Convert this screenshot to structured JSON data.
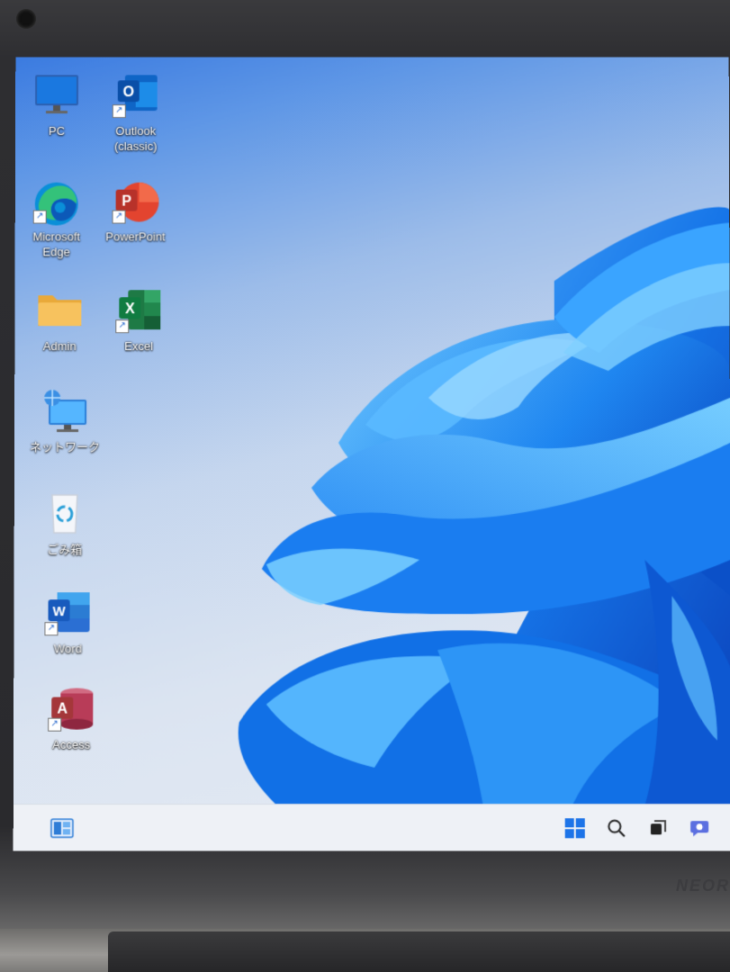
{
  "desktop": {
    "icons": [
      {
        "label": "PC",
        "icon": "monitor-icon"
      },
      {
        "label": "Outlook\n(classic)",
        "icon": "outlook-icon"
      },
      {
        "label": "Microsoft\nEdge",
        "icon": "edge-icon"
      },
      {
        "label": "PowerPoint",
        "icon": "powerpoint-icon"
      },
      {
        "label": "Admin",
        "icon": "folder-icon"
      },
      {
        "label": "Excel",
        "icon": "excel-icon"
      },
      {
        "label": "ネットワーク",
        "icon": "network-icon"
      },
      {
        "label": "ごみ箱",
        "icon": "recycle-bin-icon"
      },
      {
        "label": "Word",
        "icon": "word-icon"
      },
      {
        "label": "Access",
        "icon": "access-icon"
      }
    ]
  },
  "taskbar": {
    "widgets_icon": "widgets-icon",
    "start_icon": "windows-start-icon",
    "search_icon": "search-icon",
    "taskview_icon": "task-view-icon",
    "chat_icon": "chat-icon"
  },
  "chassis": {
    "brand": "NEOR"
  },
  "colors": {
    "accent_blue": "#1d74e8",
    "taskbar_bg": "#eef1f6"
  }
}
